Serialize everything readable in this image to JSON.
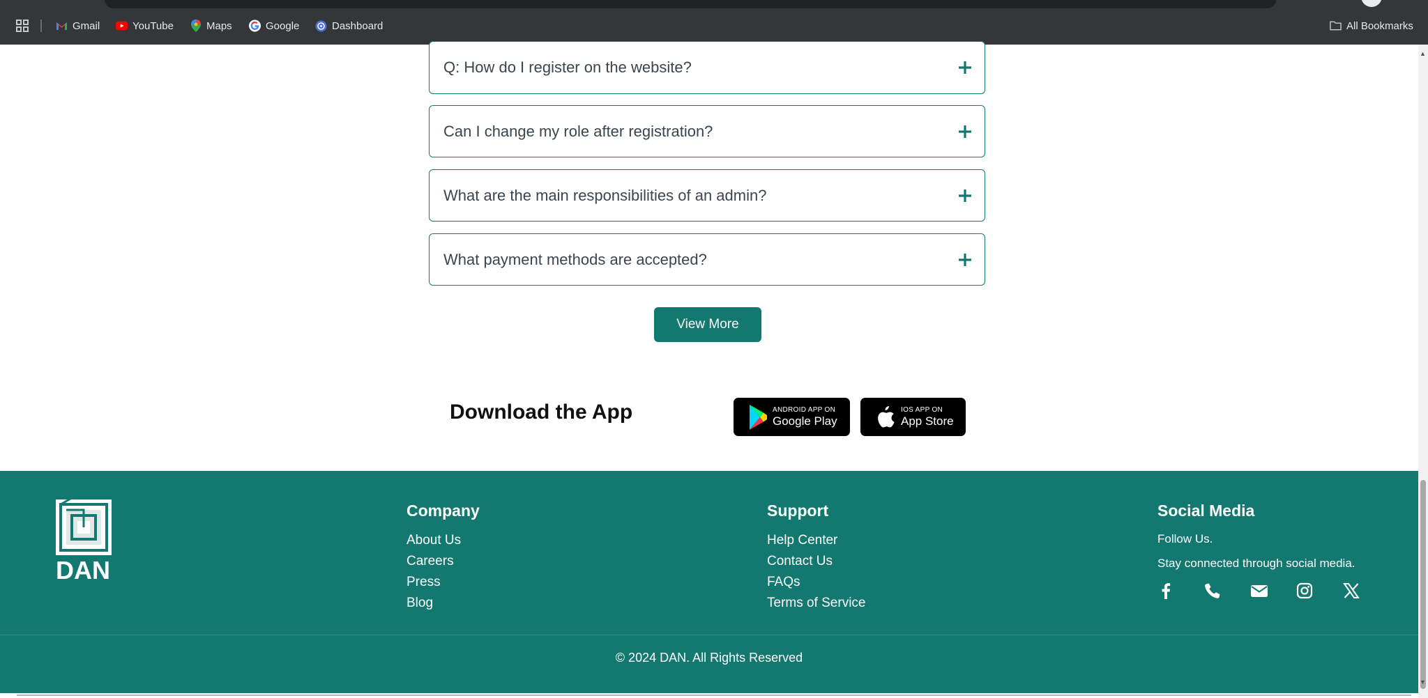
{
  "browser": {
    "bookmarks": [
      {
        "label": "Gmail",
        "icon": "gmail-icon"
      },
      {
        "label": "YouTube",
        "icon": "youtube-icon"
      },
      {
        "label": "Maps",
        "icon": "maps-icon"
      },
      {
        "label": "Google",
        "icon": "google-icon"
      },
      {
        "label": "Dashboard",
        "icon": "dashboard-icon"
      }
    ],
    "all_bookmarks": "All Bookmarks"
  },
  "faq": {
    "items": [
      {
        "question": "Q: How do I register on the website?"
      },
      {
        "question": "Can I change my role after registration?"
      },
      {
        "question": "What are the main responsibilities of an admin?"
      },
      {
        "question": "What payment methods are accepted?"
      }
    ],
    "view_more": "View More"
  },
  "download": {
    "title": "Download the App",
    "google_play": {
      "small": "ANDROID APP ON",
      "big": "Google Play"
    },
    "app_store": {
      "small": "IOS APP ON",
      "big": "App Store"
    }
  },
  "footer": {
    "brand": "DAN",
    "company": {
      "title": "Company",
      "links": [
        "About Us",
        "Careers",
        "Press",
        "Blog"
      ]
    },
    "support": {
      "title": "Support",
      "links": [
        "Help Center",
        "Contact Us",
        "FAQs",
        "Terms of Service"
      ]
    },
    "social": {
      "title": "Social Media",
      "follow": "Follow Us.",
      "tagline": "Stay connected through social media.",
      "icons": [
        "facebook-icon",
        "phone-icon",
        "email-icon",
        "instagram-icon",
        "x-icon"
      ]
    },
    "copyright": "© 2024 DAN. All Rights Reserved"
  },
  "colors": {
    "brand": "#127870",
    "bookmarks_bar": "#35363a"
  }
}
